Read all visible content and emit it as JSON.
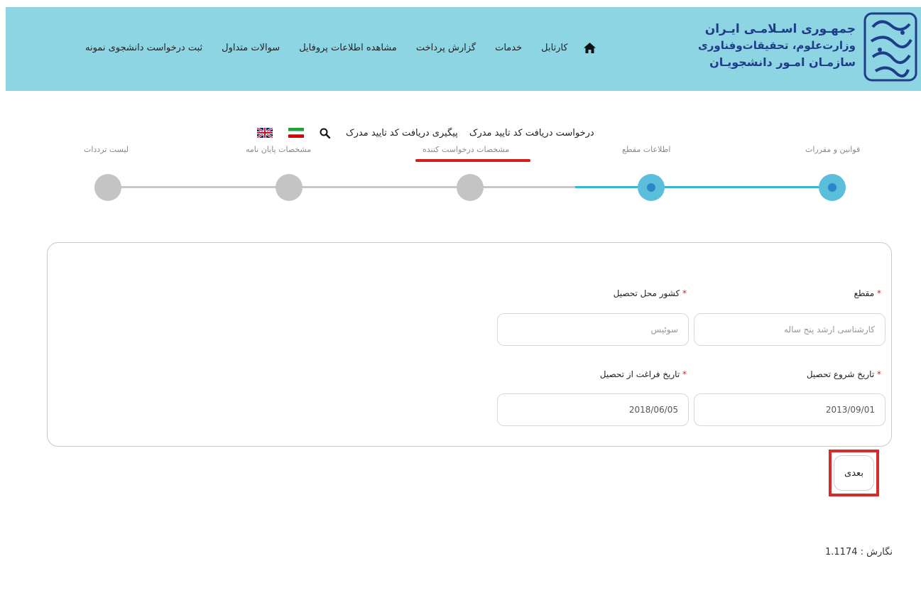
{
  "header": {
    "logo": {
      "line1": "جمهـوری اسـلامـی ایـران",
      "line2": "وزارت‌علوم، تحقیقات‌وفناوری",
      "line3": "سازمـان امـور دانشجویـان",
      "emblem_text": "سازمان امور دانشجویان"
    },
    "nav": {
      "home_icon": "home-icon",
      "items": [
        "کارتابل",
        "خدمات",
        "گزارش پرداخت",
        "مشاهده اطلاعات پروفایل",
        "سوالات متداول",
        "ثبت درخواست دانشجوی نمونه"
      ]
    },
    "colors": {
      "header_bg": "#8ed5e3",
      "logo_text": "#1f3c88"
    }
  },
  "sub_links": {
    "items": [
      "درخواست دریافت کد تایید مدرک",
      "پیگیری دریافت کد تایید مدرک"
    ],
    "search_icon": "search-icon",
    "languages": [
      "flag-iran-icon",
      "flag-uk-icon"
    ]
  },
  "steps": {
    "labels": [
      "قوانین و مقررات",
      "اطلاعات مقطع",
      "مشخصات درخواست کننده",
      "مشخصات پایان نامه",
      "لیست ترددات"
    ],
    "active_count": 2,
    "highlighted_label_index": 2,
    "colors": {
      "active": "#5bbfdc",
      "inactive": "#c4c4c4",
      "highlight": "#d11f1f"
    }
  },
  "form": {
    "fields": {
      "degree": {
        "label": "مقطع",
        "required_mark": "*",
        "placeholder": "کارشناسی ارشد پنج ساله"
      },
      "country": {
        "label": "کشور محل تحصیل",
        "required_mark": "*",
        "placeholder": "سوئیس"
      },
      "start_date": {
        "label": "تاریخ شروع تحصیل",
        "required_mark": "*",
        "value": "2013/09/01"
      },
      "end_date": {
        "label": "تاریخ فراغت از تحصیل",
        "required_mark": "*",
        "value": "2018/06/05"
      }
    }
  },
  "actions": {
    "next_label": "بعدی"
  },
  "footer": {
    "version": "نگارش : 1.1174"
  }
}
